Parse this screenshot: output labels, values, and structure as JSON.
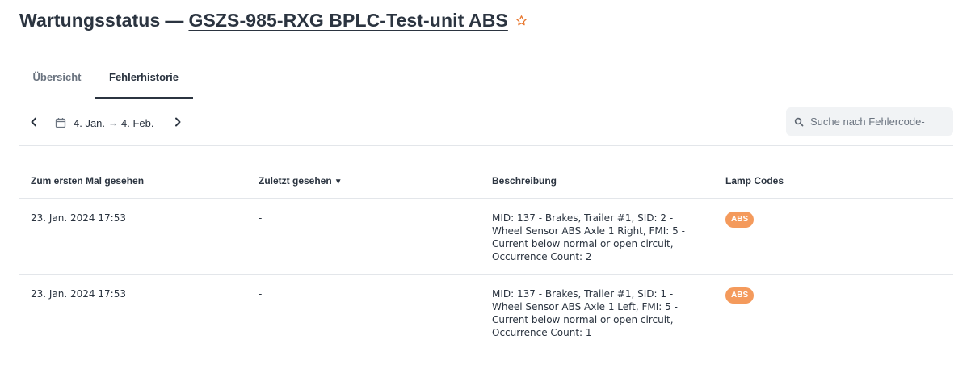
{
  "header": {
    "title": "Wartungsstatus",
    "separator": "—",
    "asset_name": "GSZS-985-RXG BPLC-Test-unit ABS",
    "star_color": "#e8772e"
  },
  "tabs": [
    {
      "label": "Übersicht",
      "active": false
    },
    {
      "label": "Fehlerhistorie",
      "active": true
    }
  ],
  "toolbar": {
    "prev_icon": "chevron-left-icon",
    "next_icon": "chevron-right-icon",
    "calendar_icon": "calendar-icon",
    "date_start": "4. Jan.",
    "date_arrow": "→",
    "date_end": "4. Feb.",
    "search_placeholder": "Suche nach Fehlercode-",
    "search_value": ""
  },
  "table": {
    "columns": [
      "Zum ersten Mal gesehen",
      "Zuletzt gesehen",
      "Beschreibung",
      "Lamp Codes"
    ],
    "sort_indicator": "▼",
    "rows": [
      {
        "first_seen": "23. Jan. 2024 17:53",
        "last_seen": "-",
        "description": "MID: 137 - Brakes, Trailer #1, SID: 2 - Wheel Sensor ABS Axle 1 Right, FMI: 5 - Current below normal or open circuit, Occurrence Count: 2",
        "lamp_code": "ABS"
      },
      {
        "first_seen": "23. Jan. 2024 17:53",
        "last_seen": "-",
        "description": "MID: 137 - Brakes, Trailer #1, SID: 1 - Wheel Sensor ABS Axle 1 Left, FMI: 5 - Current below normal or open circuit, Occurrence Count: 1",
        "lamp_code": "ABS"
      }
    ]
  },
  "colors": {
    "text": "#2b3440",
    "muted": "#6b7480",
    "badge_abs": "#f49a5c",
    "divider": "#e3e6ea"
  }
}
